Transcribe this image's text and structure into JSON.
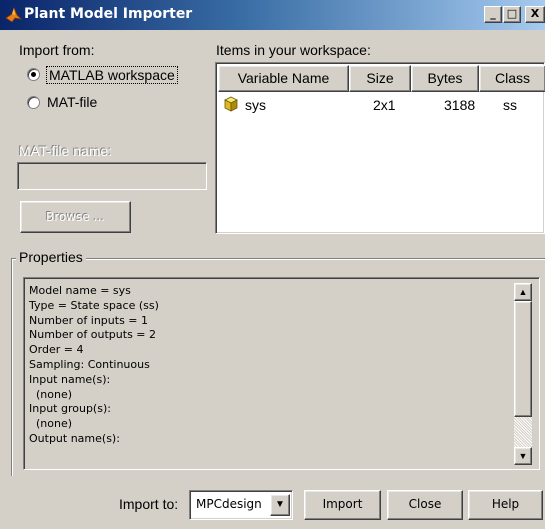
{
  "window": {
    "title": "Plant Model Importer",
    "minimize": "_",
    "maximize": "□",
    "close": "X"
  },
  "import_from": {
    "label": "Import from:",
    "options": [
      {
        "label": "MATLAB workspace",
        "selected": true
      },
      {
        "label": "MAT-file",
        "selected": false
      }
    ],
    "matfile_label": "MAT-file name:",
    "matfile_value": "",
    "browse_label": "Browse ..."
  },
  "workspace": {
    "label": "Items in your workspace:",
    "columns": [
      "Variable Name",
      "Size",
      "Bytes",
      "Class"
    ],
    "rows": [
      {
        "name": "sys",
        "size": "2x1",
        "bytes": "3188",
        "class": "ss",
        "icon": "cube-icon"
      }
    ]
  },
  "properties": {
    "label": "Properties",
    "lines": [
      "Model name = sys",
      "Type = State space (ss)",
      "Number of inputs = 1",
      "Number of outputs = 2",
      "Order = 4",
      "Sampling: Continuous",
      "Input name(s):",
      "  (none)",
      "Input group(s):",
      "  (none)",
      "Output name(s):"
    ]
  },
  "footer": {
    "import_to_label": "Import to:",
    "import_to_value": "MPCdesign",
    "import_label": "Import",
    "close_label": "Close",
    "help_label": "Help"
  },
  "colors": {
    "titlebar_start": "#0a246a",
    "titlebar_end": "#a6caf0",
    "face": "#d4d0c8"
  }
}
